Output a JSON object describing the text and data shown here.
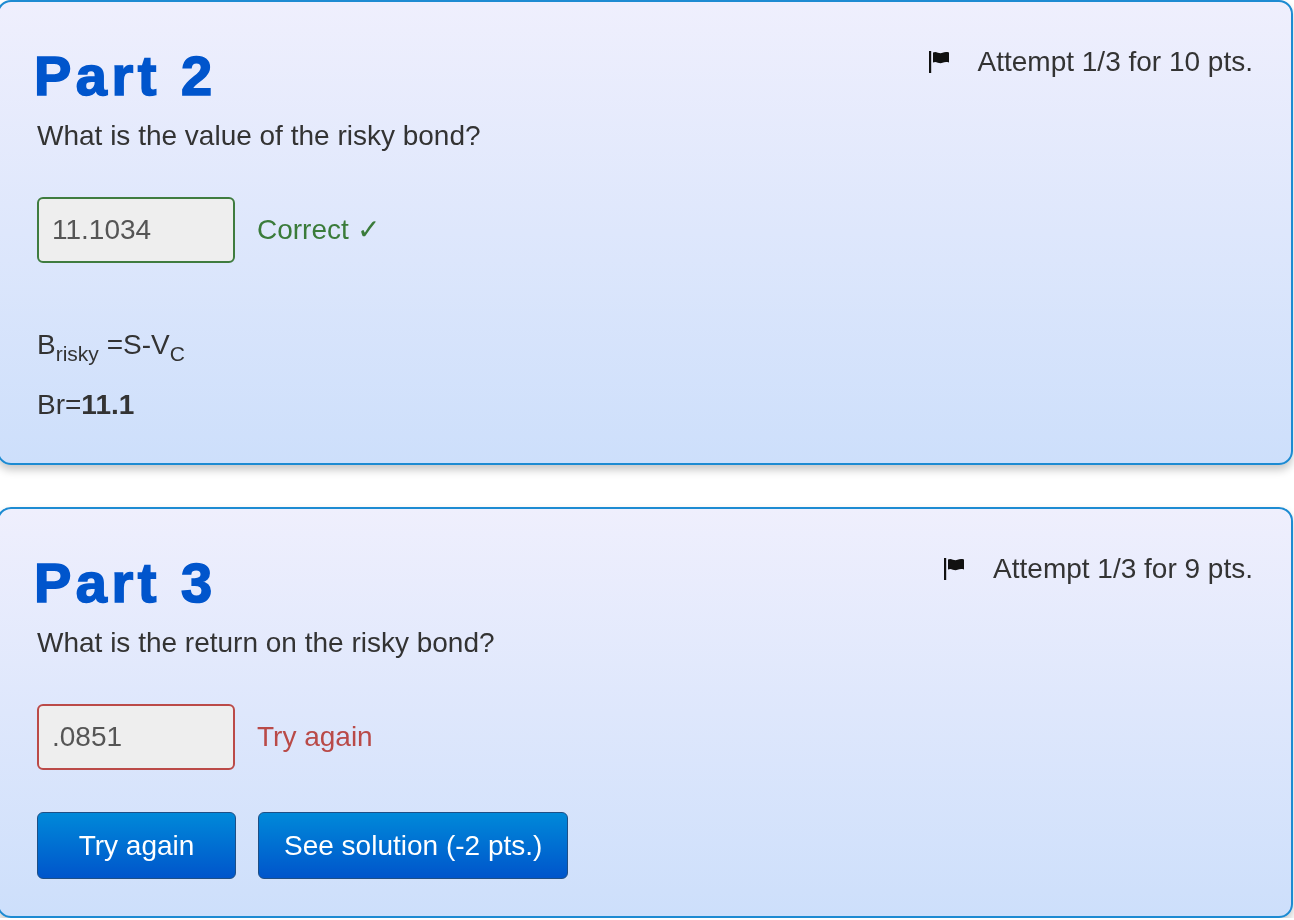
{
  "parts": [
    {
      "title": "Part 2",
      "attempt": "Attempt 1/3 for 10 pts.",
      "question": "What is the value of the risky bond?",
      "answer": {
        "value": "11.1034",
        "correct": true,
        "feedback": "Correct ✓"
      },
      "solution": [
        "B$_{risky}$ =S-V$_{C}$",
        "Br=**11.1**"
      ]
    },
    {
      "title": "Part 3",
      "attempt": "Attempt 1/3 for 9 pts.",
      "question": "What is the return on the risky bond?",
      "answer": {
        "value": ".0851",
        "correct": false,
        "feedback": "Try again"
      },
      "buttons": [
        "Try again",
        "See solution (-2 pts.)"
      ]
    }
  ]
}
